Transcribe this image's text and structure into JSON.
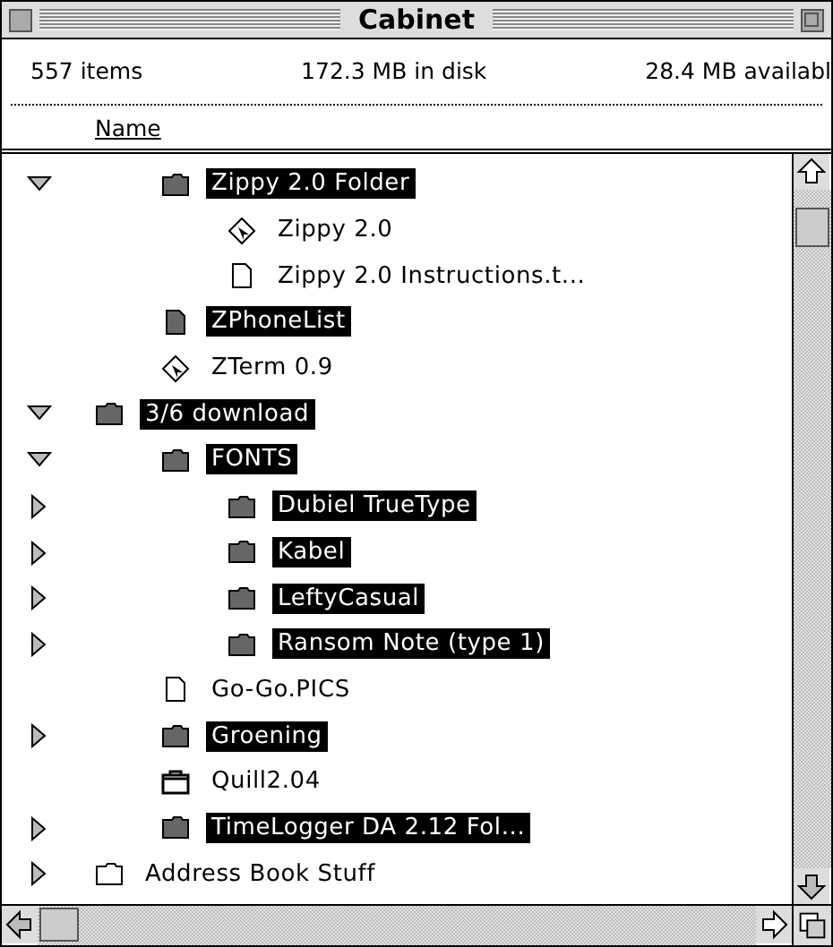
{
  "window": {
    "title": "Cabinet"
  },
  "info": {
    "items": "557 items",
    "in_disk": "172.3 MB in disk",
    "available": "28.4 MB availabl"
  },
  "columns": [
    {
      "label": "Name",
      "selected": true
    }
  ],
  "items": [
    {
      "children": [
        {
          "name": "Zippy 2.0 Folder",
          "kind": "folder",
          "selected": true,
          "expanded": true,
          "children": [
            {
              "name": "Zippy 2.0",
              "kind": "application",
              "selected": false
            },
            {
              "name": "Zippy 2.0 Instructions.t...",
              "kind": "document",
              "selected": false
            }
          ]
        },
        {
          "name": "ZPhoneList",
          "kind": "document-dark",
          "selected": true
        },
        {
          "name": "ZTerm 0.9",
          "kind": "application",
          "selected": false
        }
      ]
    },
    {
      "name": "3/6 download",
      "kind": "folder",
      "selected": true,
      "expanded": true,
      "children": [
        {
          "name": "FONTS",
          "kind": "folder",
          "selected": true,
          "expanded": true,
          "children": [
            {
              "name": "Dubiel TrueType",
              "kind": "folder",
              "selected": true,
              "expanded": false
            },
            {
              "name": "Kabel",
              "kind": "folder",
              "selected": true,
              "expanded": false
            },
            {
              "name": "LeftyCasual",
              "kind": "folder",
              "selected": true,
              "expanded": false
            },
            {
              "name": "Ransom Note (type 1)",
              "kind": "folder",
              "selected": true,
              "expanded": false
            }
          ]
        },
        {
          "name": "Go-Go.PICS",
          "kind": "document",
          "selected": false
        },
        {
          "name": "Groening",
          "kind": "folder",
          "selected": true,
          "expanded": false
        },
        {
          "name": "Quill2.04",
          "kind": "suitcase",
          "selected": false
        },
        {
          "name": "TimeLogger DA 2.12 Fol...",
          "kind": "folder",
          "selected": true,
          "expanded": false
        }
      ]
    },
    {
      "name": "Address Book Stuff",
      "kind": "folder-light",
      "selected": false,
      "expanded": false
    }
  ]
}
